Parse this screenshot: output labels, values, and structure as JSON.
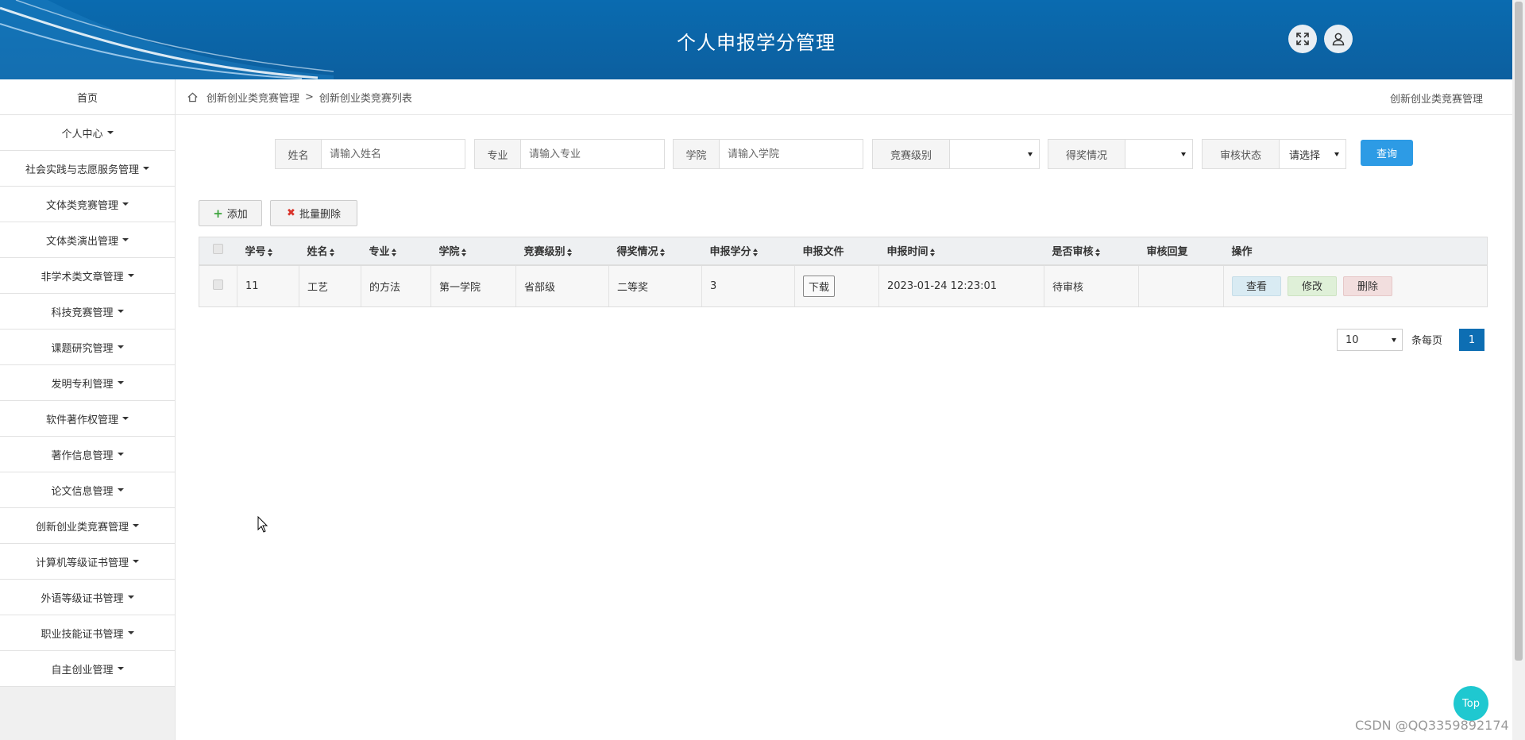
{
  "header": {
    "title": "个人申报学分管理",
    "fullscreen_icon": "expand-icon",
    "user_icon": "user-icon",
    "bg_color": "#0a6bb0"
  },
  "sidebar": {
    "items": [
      {
        "label": "首页",
        "has_caret": false
      },
      {
        "label": "个人中心",
        "has_caret": true
      },
      {
        "label": "社会实践与志愿服务管理",
        "has_caret": true
      },
      {
        "label": "文体类竞赛管理",
        "has_caret": true
      },
      {
        "label": "文体类演出管理",
        "has_caret": true
      },
      {
        "label": "非学术类文章管理",
        "has_caret": true
      },
      {
        "label": "科技竞赛管理",
        "has_caret": true
      },
      {
        "label": "课题研究管理",
        "has_caret": true
      },
      {
        "label": "发明专利管理",
        "has_caret": true
      },
      {
        "label": "软件著作权管理",
        "has_caret": true
      },
      {
        "label": "著作信息管理",
        "has_caret": true
      },
      {
        "label": "论文信息管理",
        "has_caret": true
      },
      {
        "label": "创新创业类竞赛管理",
        "has_caret": true
      },
      {
        "label": "计算机等级证书管理",
        "has_caret": true
      },
      {
        "label": "外语等级证书管理",
        "has_caret": true
      },
      {
        "label": "职业技能证书管理",
        "has_caret": true
      },
      {
        "label": "自主创业管理",
        "has_caret": true
      }
    ]
  },
  "breadcrumb": {
    "home_icon": "home-icon",
    "level1": "创新创业类竞赛管理",
    "separator": ">",
    "level2": "创新创业类竞赛列表",
    "right_title": "创新创业类竞赛管理"
  },
  "search": {
    "name": {
      "label": "姓名",
      "placeholder": "请输入姓名"
    },
    "major": {
      "label": "专业",
      "placeholder": "请输入专业"
    },
    "college": {
      "label": "学院",
      "placeholder": "请输入学院"
    },
    "level": {
      "label": "竞赛级别",
      "value": ""
    },
    "award": {
      "label": "得奖情况",
      "value": ""
    },
    "status": {
      "label": "审核状态",
      "value": "请选择"
    },
    "query_label": "查询"
  },
  "actions": {
    "add_label": "添加",
    "batch_delete_label": "批量删除"
  },
  "table": {
    "headers": {
      "sid": "学号",
      "name": "姓名",
      "major": "专业",
      "college": "学院",
      "level": "竞赛级别",
      "award": "得奖情况",
      "credit": "申报学分",
      "file": "申报文件",
      "time": "申报时间",
      "audited": "是否审核",
      "reply": "审核回复",
      "ops": "操作"
    },
    "rows": [
      {
        "sid": "11",
        "name": "工艺",
        "major": "的方法",
        "college": "第一学院",
        "level": "省部级",
        "award": "二等奖",
        "credit": "3",
        "file_button": "下载",
        "time": "2023-01-24 12:23:01",
        "audited": "待审核",
        "reply": "",
        "view": "查看",
        "edit": "修改",
        "delete": "删除"
      }
    ]
  },
  "pagination": {
    "page_size": "10",
    "per_page_text": "条每页",
    "current_page": "1"
  },
  "top_button": "Top",
  "watermark": "CSDN @QQ3359892174"
}
